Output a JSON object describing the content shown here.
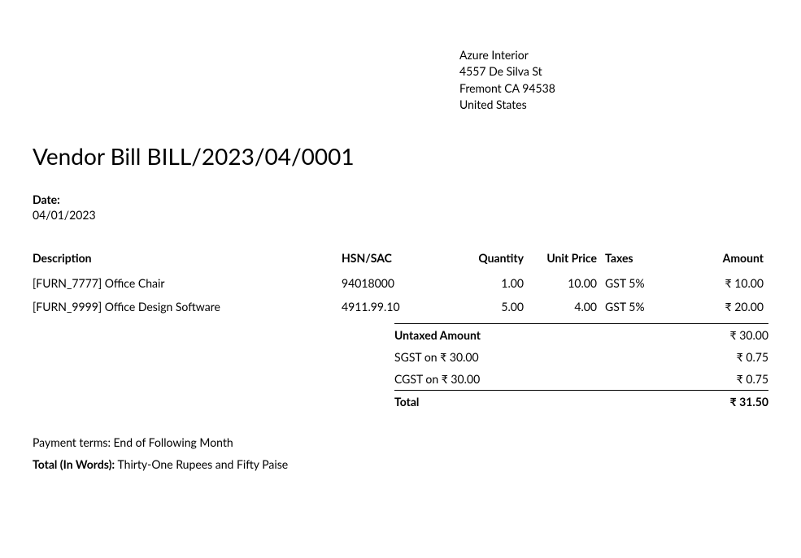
{
  "vendor": {
    "name": "Azure Interior",
    "street": "4557 De Silva St",
    "city_line": "Fremont CA 94538",
    "country": "United States"
  },
  "title": "Vendor Bill BILL/2023/04/0001",
  "date": {
    "label": "Date:",
    "value": "04/01/2023"
  },
  "headers": {
    "description": "Description",
    "hsn": "HSN/SAC",
    "quantity": "Quantity",
    "unit_price": "Unit Price",
    "taxes": "Taxes",
    "amount": "Amount"
  },
  "lines": [
    {
      "description": "[FURN_7777] Office Chair",
      "hsn": "94018000",
      "qty": "1.00",
      "unit_price": "10.00",
      "taxes": "GST 5%",
      "amount": "₹ 10.00"
    },
    {
      "description": "[FURN_9999] Office Design Software",
      "hsn": "4911.99.10",
      "qty": "5.00",
      "unit_price": "4.00",
      "taxes": "GST 5%",
      "amount": "₹ 20.00"
    }
  ],
  "totals": {
    "untaxed_label": "Untaxed Amount",
    "untaxed_value": "₹ 30.00",
    "sgst_label": "SGST on ₹ 30.00",
    "sgst_value": "₹ 0.75",
    "cgst_label": "CGST on ₹ 30.00",
    "cgst_value": "₹ 0.75",
    "total_label": "Total",
    "total_value": "₹ 31.50"
  },
  "footer": {
    "payment_terms": "Payment terms: End of Following Month",
    "total_words_label": "Total (In Words): ",
    "total_words_value": "Thirty-One Rupees and Fifty Paise"
  }
}
